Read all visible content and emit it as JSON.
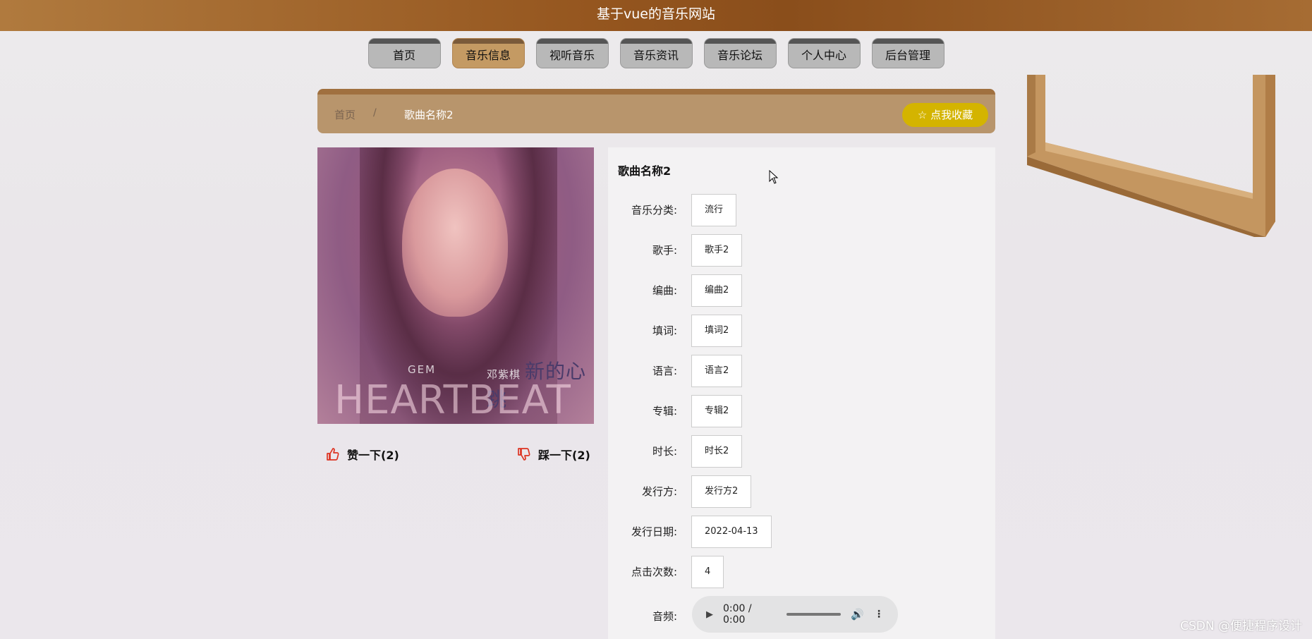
{
  "header": {
    "title": "基于vue的音乐网站"
  },
  "nav": {
    "items": [
      {
        "label": "首页",
        "active": false
      },
      {
        "label": "音乐信息",
        "active": true
      },
      {
        "label": "视听音乐",
        "active": false
      },
      {
        "label": "音乐资讯",
        "active": false
      },
      {
        "label": "音乐论坛",
        "active": false
      },
      {
        "label": "个人中心",
        "active": false
      },
      {
        "label": "后台管理",
        "active": false
      }
    ]
  },
  "breadcrumb": {
    "home": "首页",
    "separator": "/",
    "current": "歌曲名称2"
  },
  "favorite_button": {
    "label": "点我收藏",
    "icon": "star-outline-icon"
  },
  "cover": {
    "artist_en": "GEM",
    "artist_cn": "邓紫棋",
    "title_cn": "新的心跳",
    "title_en": "HEARTBEAT"
  },
  "votes": {
    "like_label": "赞一下(2)",
    "dislike_label": "踩一下(2)"
  },
  "song": {
    "title": "歌曲名称2",
    "fields": [
      {
        "label": "音乐分类:",
        "value": "流行"
      },
      {
        "label": "歌手:",
        "value": "歌手2"
      },
      {
        "label": "编曲:",
        "value": "编曲2"
      },
      {
        "label": "填词:",
        "value": "填词2"
      },
      {
        "label": "语言:",
        "value": "语言2"
      },
      {
        "label": "专辑:",
        "value": "专辑2"
      },
      {
        "label": "时长:",
        "value": "时长2"
      },
      {
        "label": "发行方:",
        "value": "发行方2"
      },
      {
        "label": "发行日期:",
        "value": "2022-04-13"
      },
      {
        "label": "点击次数:",
        "value": "4"
      }
    ],
    "audio": {
      "label": "音频:",
      "time": "0:00 / 0:00"
    }
  },
  "colors": {
    "accent": "#c49a63",
    "header": "#8a4e1b",
    "favorite": "#d4b400"
  },
  "watermark": "CSDN @便捷程序设计"
}
